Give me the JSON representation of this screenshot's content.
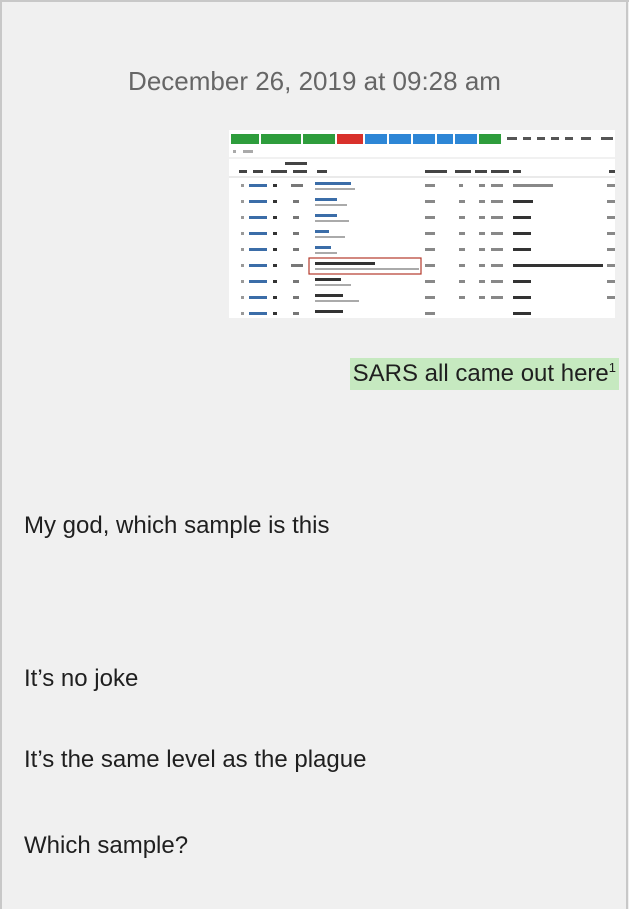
{
  "timestamp": "December 26, 2019 at 09:28 am",
  "screenshot": {
    "description_icon": "spreadsheet-screenshot-image",
    "toolbar_colors": [
      "#2e9d3c",
      "#2e9d3c",
      "#2e9d3c",
      "#d9312b",
      "#2d86d6",
      "#2d86d6",
      "#2d86d6",
      "#2d86d6",
      "#2d86d6",
      "#2e9d3c"
    ],
    "highlight_color": "#b33a2b"
  },
  "caption": {
    "text": "SARS all came out here",
    "footnote": "1",
    "highlight": "#c6e9c0"
  },
  "messages": [
    "My god, which sample is this",
    "It’s no joke",
    "It’s the same level as the plague",
    "Which sample?"
  ]
}
